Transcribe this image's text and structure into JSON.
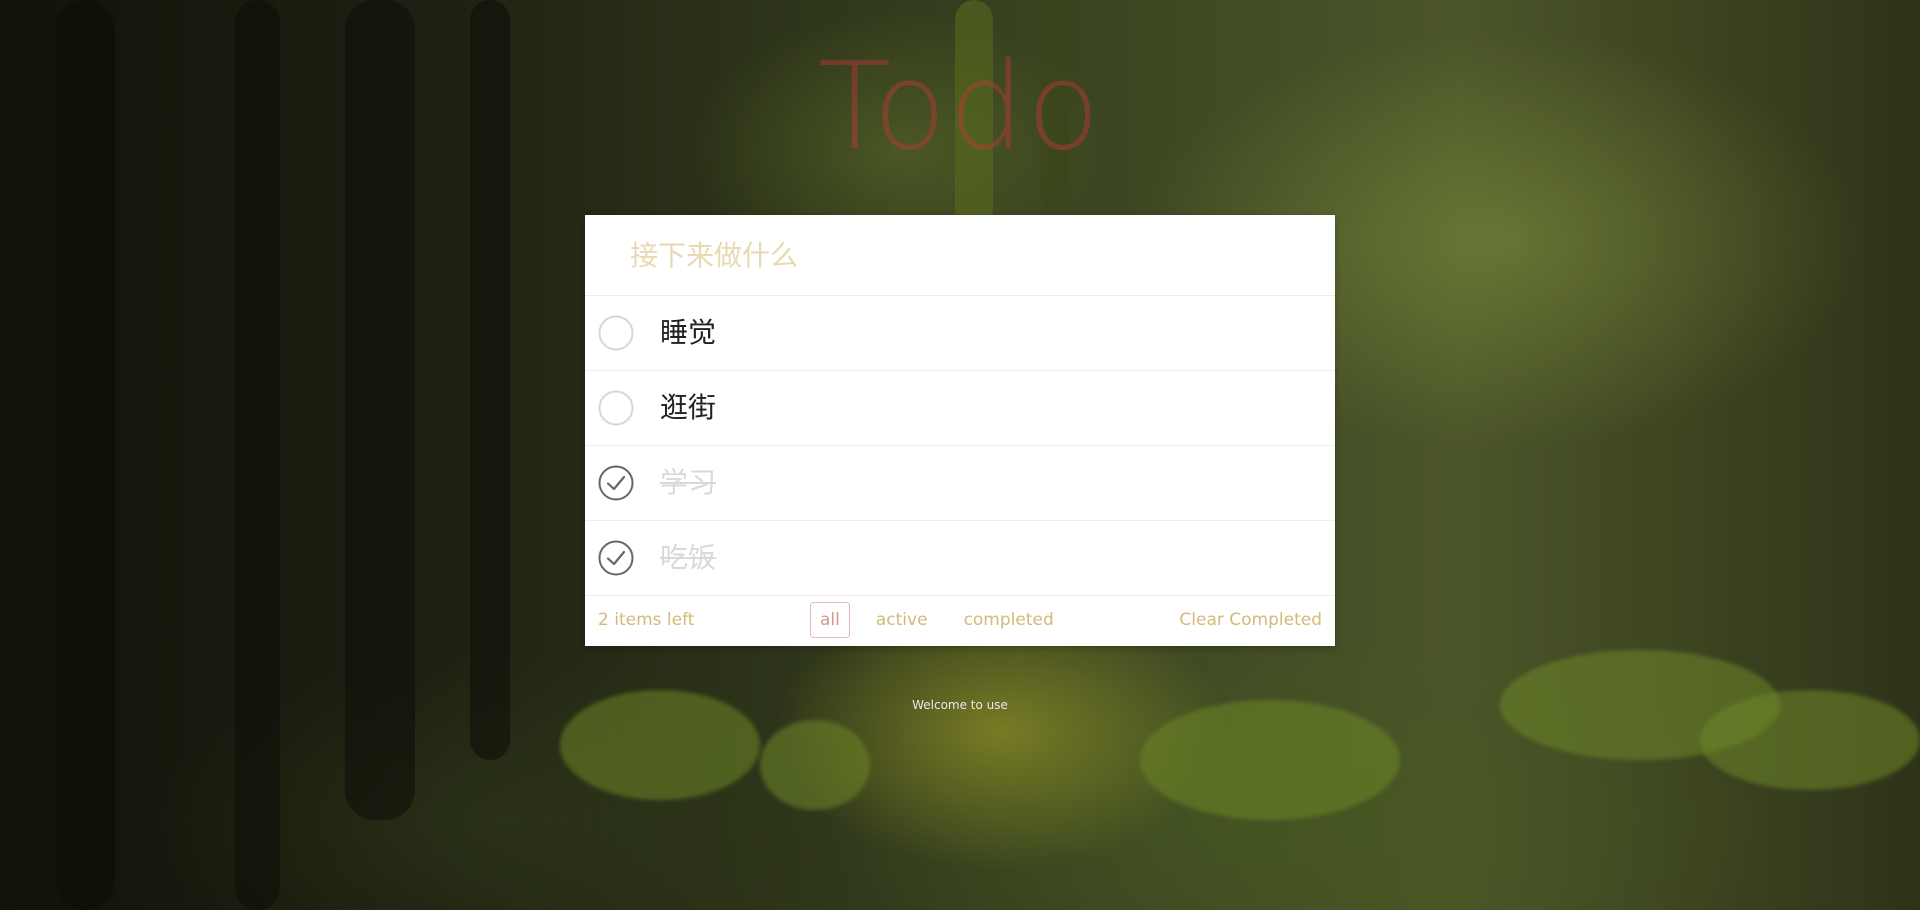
{
  "app": {
    "title": "Todo"
  },
  "input": {
    "placeholder": "接下来做什么",
    "value": ""
  },
  "todos": [
    {
      "text": "睡觉",
      "completed": false
    },
    {
      "text": "逛街",
      "completed": false
    },
    {
      "text": "学习",
      "completed": true
    },
    {
      "text": "吃饭",
      "completed": true
    }
  ],
  "footer": {
    "items_left": "2 items left",
    "filters": [
      {
        "label": "all",
        "selected": true
      },
      {
        "label": "active",
        "selected": false
      },
      {
        "label": "completed",
        "selected": false
      }
    ],
    "clear_label": "Clear Completed"
  },
  "welcome": "Welcome to use",
  "icons": {
    "unchecked": "circle-icon",
    "checked": "check-circle-icon"
  },
  "colors": {
    "title": "#be3737",
    "accent": "#d4b979",
    "selected_filter_border": "#e3b8b8",
    "completed_text": "#d9d9d9"
  }
}
